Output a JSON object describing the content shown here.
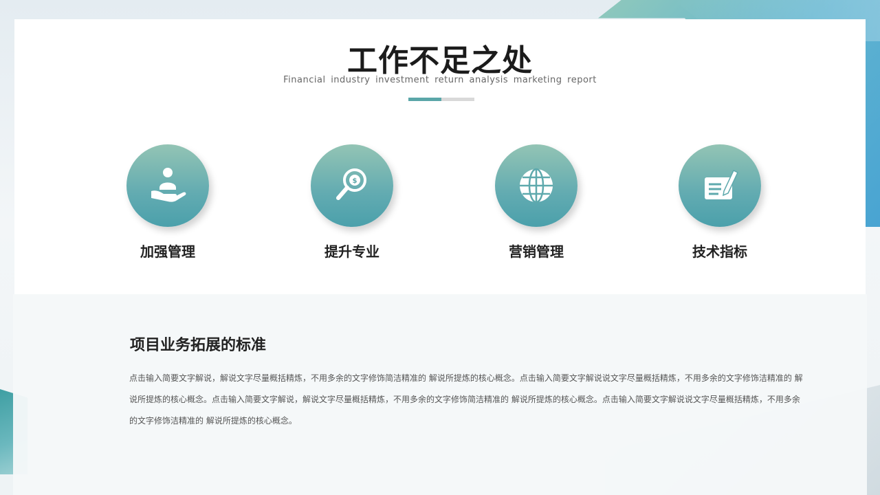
{
  "slide": {
    "title": "工作不足之处",
    "subtitle": "Financial industry investment return analysis marketing report"
  },
  "features": [
    {
      "label": "加强管理",
      "icon": "person-hand-icon"
    },
    {
      "label": "提升专业",
      "icon": "magnifier-dollar-icon"
    },
    {
      "label": "营销管理",
      "icon": "globe-icon"
    },
    {
      "label": "技术指标",
      "icon": "pen-document-icon"
    }
  ],
  "section": {
    "title": "项目业务拓展的标准",
    "body": "点击输入简要文字解说，解说文字尽量概括精炼，不用多余的文字修饰简洁精准的 解说所提炼的核心概念。点击输入简要文字解说说文字尽量概括精炼，不用多余的文字修饰洁精准的  解说所提炼的核心概念。点击输入简要文字解说，解说文字尽量概括精炼，不用多余的文字修饰简洁精准的  解说所提炼的核心概念。点击输入简要文字解说说文字尽量概括精炼，不用多余的文字修饰洁精准的   解说所提炼的核心概念。"
  },
  "colors": {
    "accent": "#5aa6a8",
    "circle_top": "#93c4b4",
    "circle_bottom": "#4ba0ab",
    "title": "#1b1b1b"
  }
}
